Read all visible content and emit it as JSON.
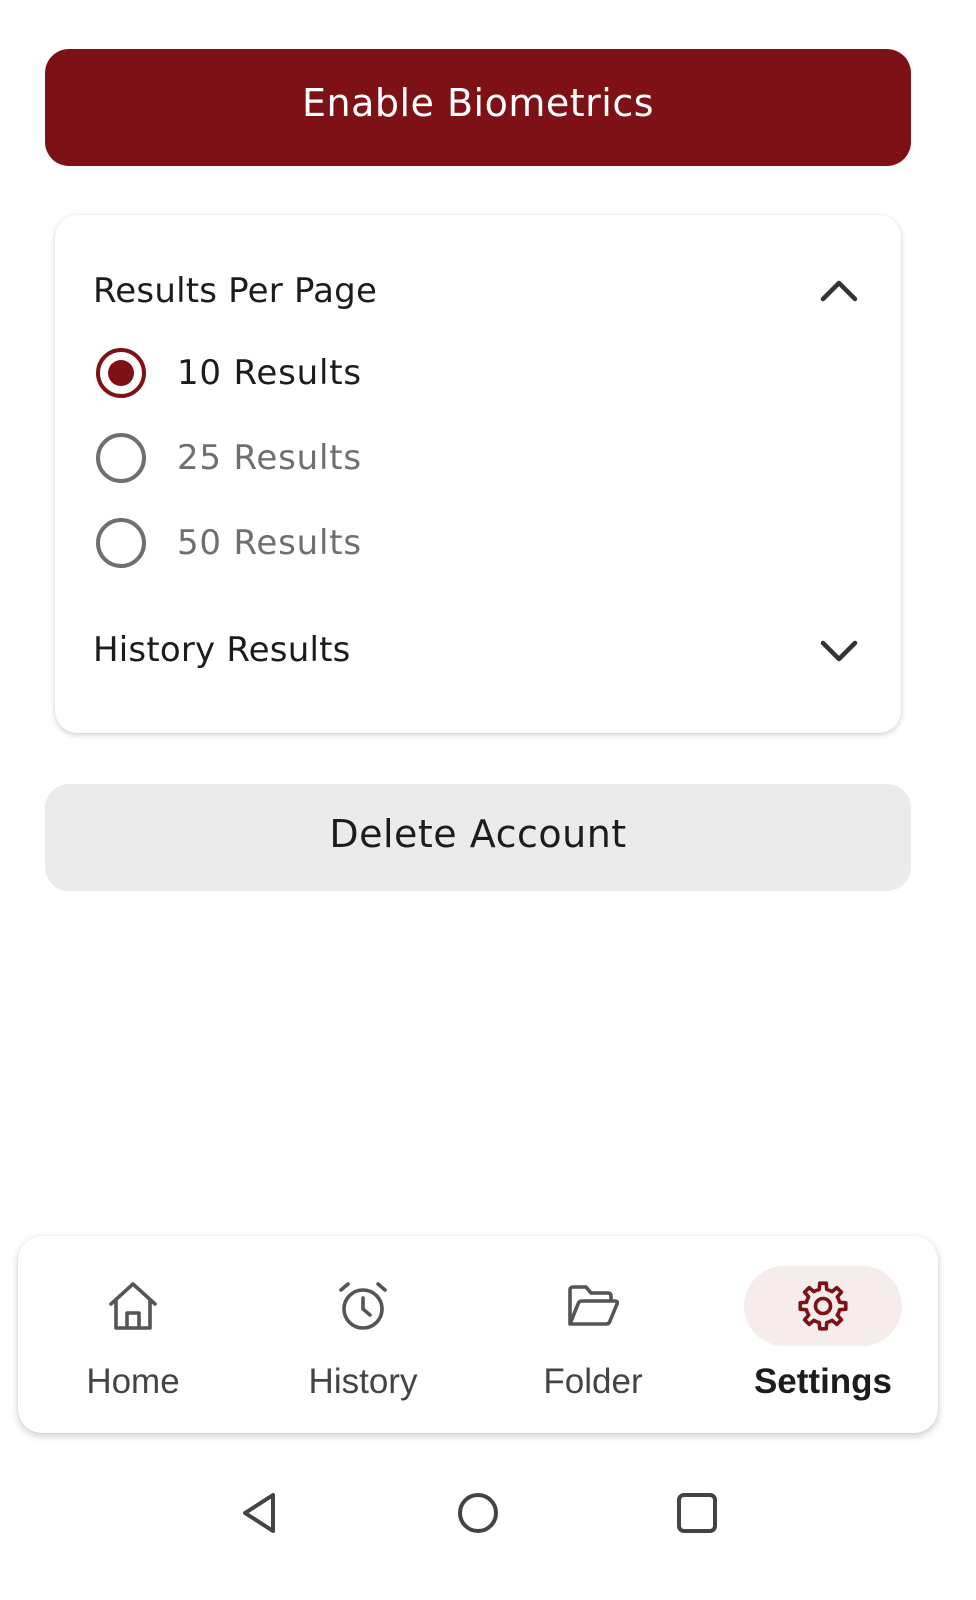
{
  "colors": {
    "brand": "#7d1116",
    "secondary_button_bg": "#ebebeb",
    "active_nav_bg": "#f6ecec",
    "unselected_text": "#6f6f6f"
  },
  "biometrics_button": {
    "label": "Enable Biometrics"
  },
  "results_per_page": {
    "title": "Results Per Page",
    "expanded": true,
    "options": [
      {
        "label": "10 Results",
        "selected": true
      },
      {
        "label": "25 Results",
        "selected": false
      },
      {
        "label": "50 Results",
        "selected": false
      }
    ]
  },
  "history_results": {
    "title": "History Results",
    "expanded": false
  },
  "delete_button": {
    "label": "Delete Account"
  },
  "bottom_nav": {
    "items": [
      {
        "label": "Home",
        "icon": "home-icon",
        "active": false
      },
      {
        "label": "History",
        "icon": "alarm-clock-icon",
        "active": false
      },
      {
        "label": "Folder",
        "icon": "folder-open-icon",
        "active": false
      },
      {
        "label": "Settings",
        "icon": "gear-icon",
        "active": true
      }
    ]
  },
  "system_nav": {
    "buttons": [
      "back-triangle-icon",
      "home-circle-icon",
      "recents-square-icon"
    ]
  }
}
